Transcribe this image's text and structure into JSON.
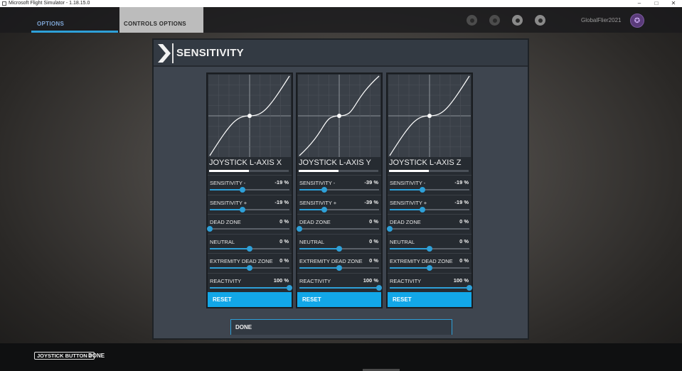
{
  "window": {
    "title": "Microsoft Flight Simulator - 1.18.15.0",
    "minimize_glyph": "–",
    "maximize_glyph": "□",
    "close_glyph": "✕"
  },
  "nav": {
    "tabs": [
      {
        "label": "OPTIONS"
      },
      {
        "label": "CONTROLS OPTIONS"
      }
    ],
    "status_icons": [
      "achievements-icon",
      "friends-icon",
      "profile-icon",
      "notifications-icon"
    ],
    "username": "GlobalFlier2021",
    "avatar_glyph": "✪"
  },
  "panel": {
    "title": "SENSITIVITY",
    "icon": "chevron-right-icon",
    "axes": [
      {
        "name": "JOYSTICK L-AXIS X",
        "selected_fraction": 0.5,
        "settings": [
          {
            "label": "SENSITIVITY -",
            "value": "-19 %",
            "fraction": 0.41
          },
          {
            "label": "SENSITIVITY +",
            "value": "-19 %",
            "fraction": 0.41
          },
          {
            "label": "DEAD ZONE",
            "value": "0 %",
            "fraction": 0.0
          },
          {
            "label": "NEUTRAL",
            "value": "0 %",
            "fraction": 0.5
          },
          {
            "label": "EXTREMITY DEAD ZONE",
            "value": "0 %",
            "fraction": 0.5
          },
          {
            "label": "REACTIVITY",
            "value": "100 %",
            "fraction": 1.0
          }
        ],
        "reset_label": "RESET"
      },
      {
        "name": "JOYSTICK L-AXIS Y",
        "selected_fraction": 0.5,
        "settings": [
          {
            "label": "SENSITIVITY -",
            "value": "-39 %",
            "fraction": 0.31
          },
          {
            "label": "SENSITIVITY +",
            "value": "-39 %",
            "fraction": 0.31
          },
          {
            "label": "DEAD ZONE",
            "value": "0 %",
            "fraction": 0.0
          },
          {
            "label": "NEUTRAL",
            "value": "0 %",
            "fraction": 0.5
          },
          {
            "label": "EXTREMITY DEAD ZONE",
            "value": "0 %",
            "fraction": 0.5
          },
          {
            "label": "REACTIVITY",
            "value": "100 %",
            "fraction": 1.0
          }
        ],
        "reset_label": "RESET"
      },
      {
        "name": "JOYSTICK L-AXIS Z",
        "selected_fraction": 0.5,
        "settings": [
          {
            "label": "SENSITIVITY -",
            "value": "-19 %",
            "fraction": 0.41
          },
          {
            "label": "SENSITIVITY +",
            "value": "-19 %",
            "fraction": 0.41
          },
          {
            "label": "DEAD ZONE",
            "value": "0 %",
            "fraction": 0.0
          },
          {
            "label": "NEUTRAL",
            "value": "0 %",
            "fraction": 0.5
          },
          {
            "label": "EXTREMITY DEAD ZONE",
            "value": "0 %",
            "fraction": 0.5
          },
          {
            "label": "REACTIVITY",
            "value": "100 %",
            "fraction": 1.0
          }
        ],
        "reset_label": "RESET"
      }
    ],
    "done_label": "DONE"
  },
  "bottombar": {
    "key_hint": "JOYSTICK BUTTON 2",
    "hint_label": "DONE"
  },
  "colors": {
    "accent": "#2ea0d8",
    "reset": "#12a7e8",
    "panel": "#3e454f",
    "card": "#262b31"
  }
}
